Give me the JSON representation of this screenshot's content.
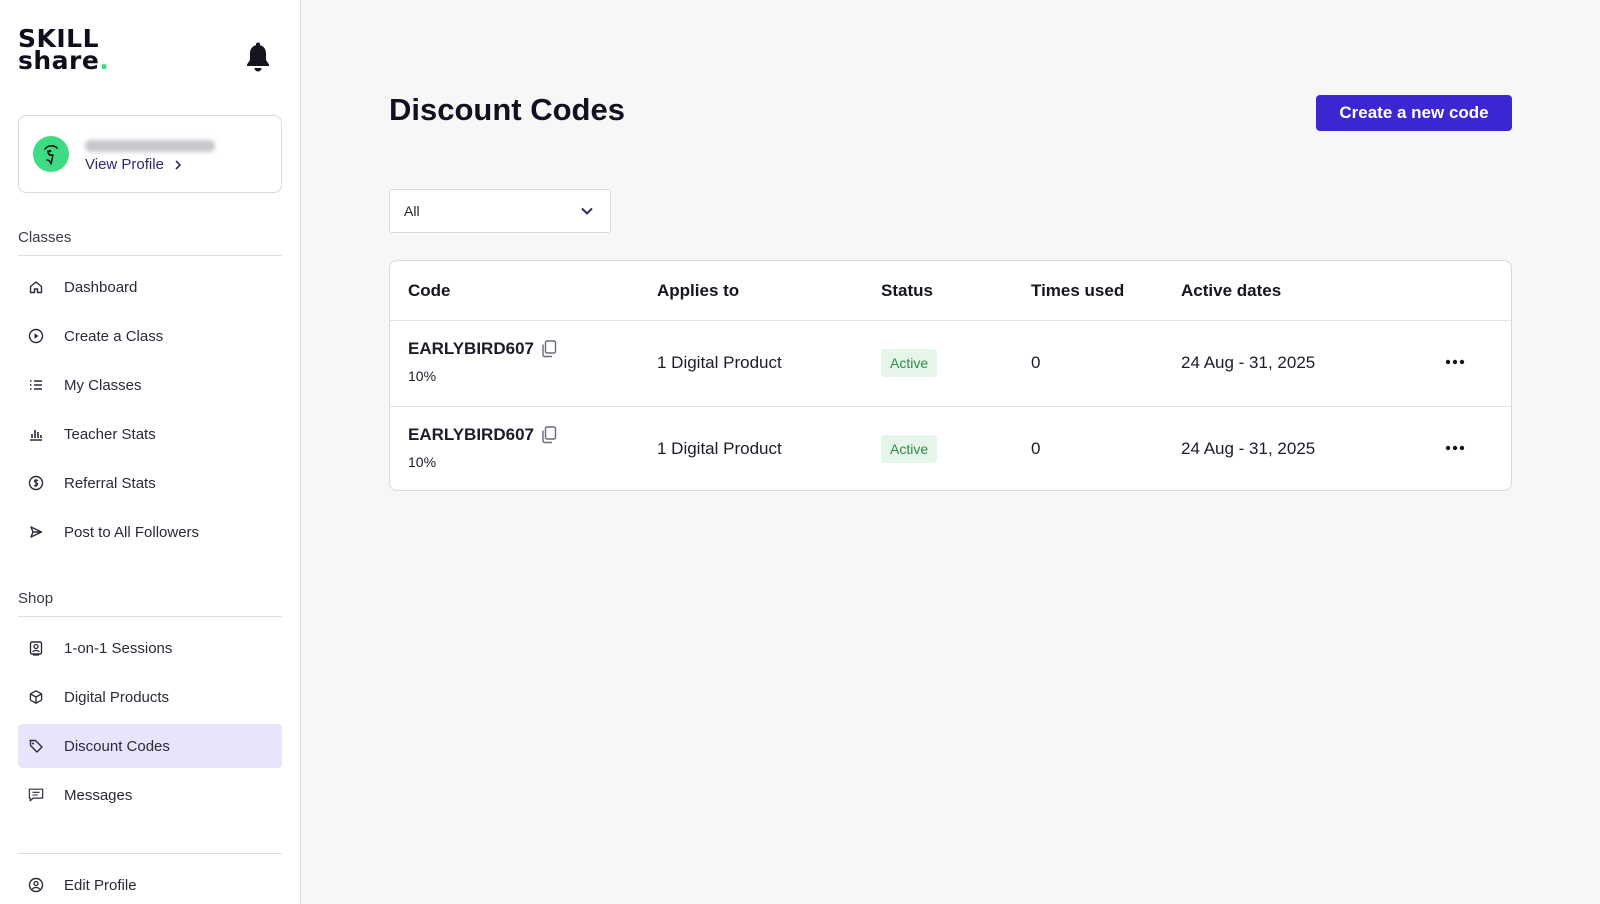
{
  "brand": {
    "logo_line1": "SKILL",
    "logo_line2": "share",
    "logo_dot": ".",
    "accent_green": "#3ddc84"
  },
  "header": {
    "notification_icon": "bell-icon"
  },
  "profile": {
    "link_label": "View Profile",
    "link_icon": "chevron-right-icon"
  },
  "sidebar": {
    "classes_label": "Classes",
    "classes_items": [
      {
        "label": "Dashboard",
        "icon": "home-icon"
      },
      {
        "label": "Create a Class",
        "icon": "play-circle-icon"
      },
      {
        "label": "My Classes",
        "icon": "list-icon"
      },
      {
        "label": "Teacher Stats",
        "icon": "bar-chart-icon"
      },
      {
        "label": "Referral Stats",
        "icon": "dollar-circle-icon"
      },
      {
        "label": "Post to All Followers",
        "icon": "send-icon"
      }
    ],
    "shop_label": "Shop",
    "shop_items": [
      {
        "label": "1-on-1 Sessions",
        "icon": "person-card-icon"
      },
      {
        "label": "Digital Products",
        "icon": "box-icon"
      },
      {
        "label": "Discount Codes",
        "icon": "tag-icon",
        "active": true
      },
      {
        "label": "Messages",
        "icon": "message-icon"
      }
    ],
    "footer_items": [
      {
        "label": "Edit Profile",
        "icon": "user-circle-icon"
      }
    ]
  },
  "main": {
    "title": "Discount Codes",
    "create_button": "Create a new code",
    "filter": {
      "selected": "All"
    },
    "table": {
      "headers": [
        "Code",
        "Applies to",
        "Status",
        "Times used",
        "Active dates"
      ],
      "rows": [
        {
          "code": "EARLYBIRD607",
          "discount": "10%",
          "applies_to": "1 Digital Product",
          "status": "Active",
          "times_used": "0",
          "active_dates": "24 Aug - 31, 2025"
        },
        {
          "code": "EARLYBIRD607",
          "discount": "10%",
          "applies_to": "1 Digital Product",
          "status": "Active",
          "times_used": "0",
          "active_dates": "24 Aug - 31, 2025"
        }
      ]
    }
  },
  "colors": {
    "primary_button": "#3a27d1",
    "active_nav": "#e7e5fb",
    "status_bg": "#e6f5ea",
    "status_text": "#2f8a4a"
  }
}
